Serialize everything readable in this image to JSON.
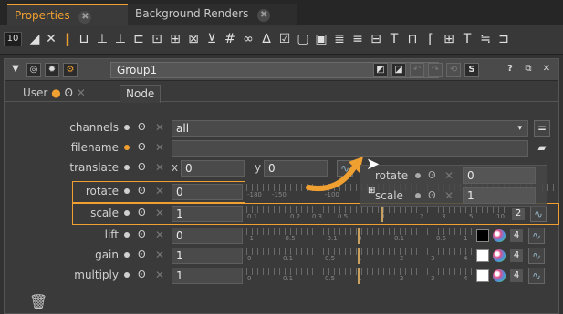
{
  "tabs": [
    {
      "label": "Properties",
      "close": "✖"
    },
    {
      "label": "Background Renders",
      "close": "✖"
    }
  ],
  "toolbar": {
    "node_count": "10"
  },
  "node_panel": {
    "name": "Group1",
    "help": "?",
    "s_label": "S"
  },
  "subtabs": {
    "user": "User",
    "node": "Node"
  },
  "knobs": {
    "channels": {
      "label": "channels",
      "value": "all"
    },
    "filename": {
      "label": "filename",
      "value": ""
    },
    "translate": {
      "label": "translate",
      "x_label": "x",
      "x_value": "0",
      "y_label": "y",
      "y_value": "0"
    },
    "rotate": {
      "label": "rotate",
      "value": "0",
      "ticks": [
        "-180",
        "-150",
        "-100"
      ]
    },
    "scale": {
      "label": "scale",
      "value": "1",
      "ticks": [
        "0.1",
        "0.2",
        "0.3",
        "0.5",
        "1",
        "2",
        "3",
        "5",
        "10"
      ],
      "chan": "2"
    },
    "lift": {
      "label": "lift",
      "value": "0",
      "ticks": [
        "-1",
        "-0.5",
        "-0.1",
        "0",
        "0.1",
        "0.5",
        "1"
      ],
      "chan": "4"
    },
    "gain": {
      "label": "gain",
      "value": "1",
      "ticks": [
        "0",
        "0.1",
        "0.5",
        "1",
        "2",
        "3",
        "4"
      ],
      "chan": "4"
    },
    "multiply": {
      "label": "multiply",
      "value": "1",
      "ticks": [
        "0",
        "0.1",
        "0.5",
        "1",
        "2",
        "3",
        "4"
      ],
      "chan": "4"
    }
  },
  "drag_ghost": {
    "rotate_label": "rotate",
    "rotate_value": "0",
    "scale_label": "scale",
    "scale_value": "1"
  },
  "colors": {
    "accent": "#f0a030",
    "background": "#323232"
  },
  "icons": [
    "trash-icon",
    "curve-editor-icon",
    "color-wheel-icon",
    "eye-icon",
    "close-icon",
    "gear-icon"
  ]
}
